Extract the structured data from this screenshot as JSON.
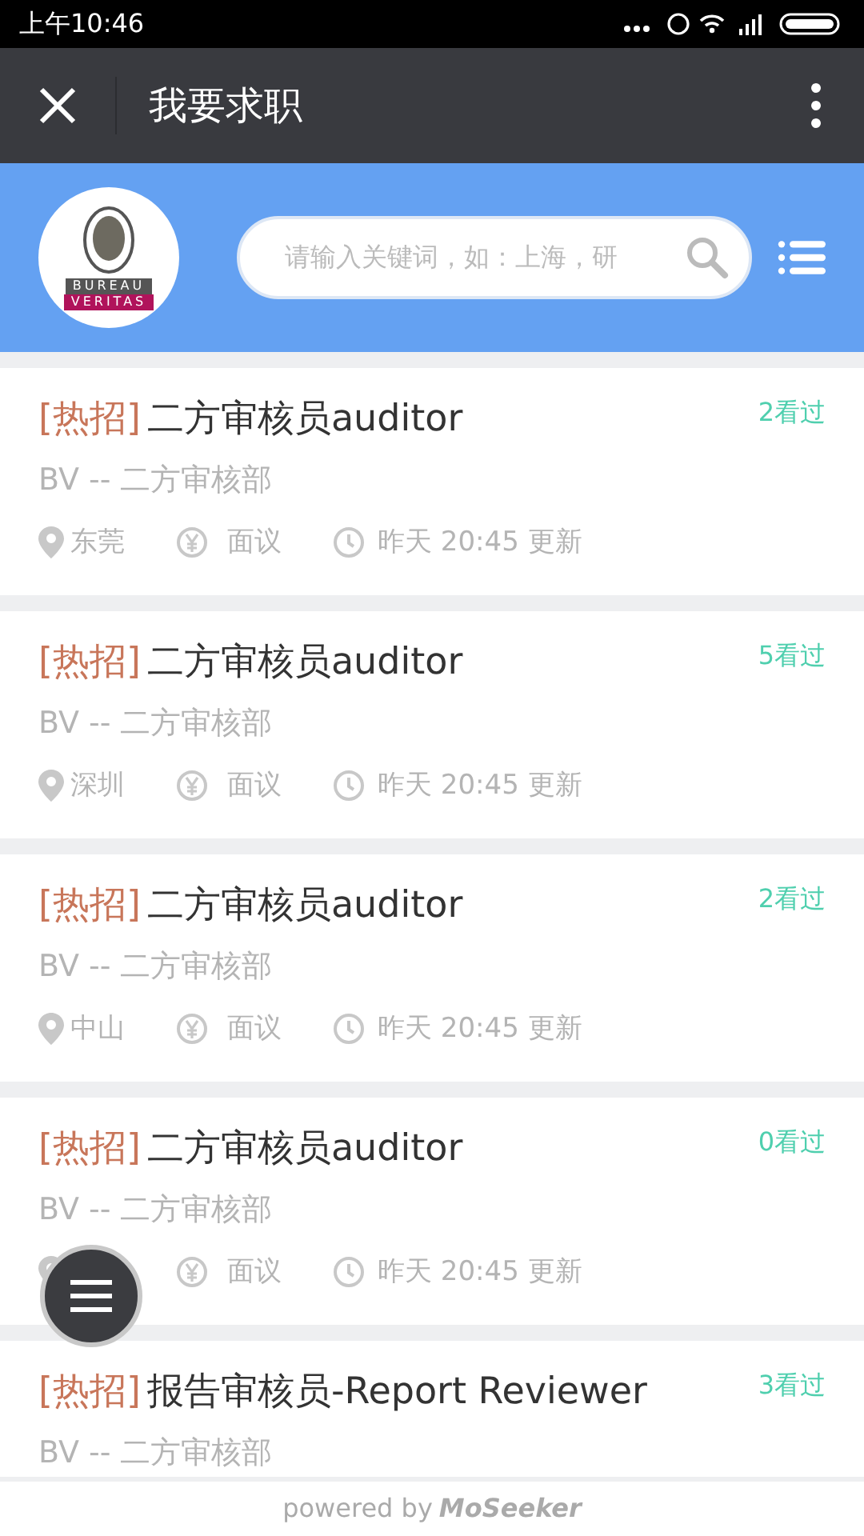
{
  "status_bar": {
    "time": "上午10:46"
  },
  "header": {
    "title": "我要求职"
  },
  "banner": {
    "logo_top": "BUREAU",
    "logo_bottom": "VERITAS",
    "search": {
      "placeholder": "请输入关键词，如：上海，研"
    }
  },
  "jobs": [
    {
      "tag": "[热招]",
      "title": "二方审核员auditor",
      "views": "2看过",
      "department": "BV -- 二方审核部",
      "location": "东莞",
      "salary": "面议",
      "updated": "昨天 20:45 更新"
    },
    {
      "tag": "[热招]",
      "title": "二方审核员auditor",
      "views": "5看过",
      "department": "BV -- 二方审核部",
      "location": "深圳",
      "salary": "面议",
      "updated": "昨天 20:45 更新"
    },
    {
      "tag": "[热招]",
      "title": "二方审核员auditor",
      "views": "2看过",
      "department": "BV -- 二方审核部",
      "location": "中山",
      "salary": "面议",
      "updated": "昨天 20:45 更新"
    },
    {
      "tag": "[热招]",
      "title": "二方审核员auditor",
      "views": "0看过",
      "department": "BV -- 二方审核部",
      "salary": "面议",
      "updated": "昨天 20:45 更新"
    },
    {
      "tag": "[热招]",
      "title": "报告审核员-Report Reviewer",
      "views": "3看过",
      "department": "BV -- 二方审核部"
    }
  ],
  "footer": {
    "text": "powered by",
    "brand": "MoSeeker"
  }
}
